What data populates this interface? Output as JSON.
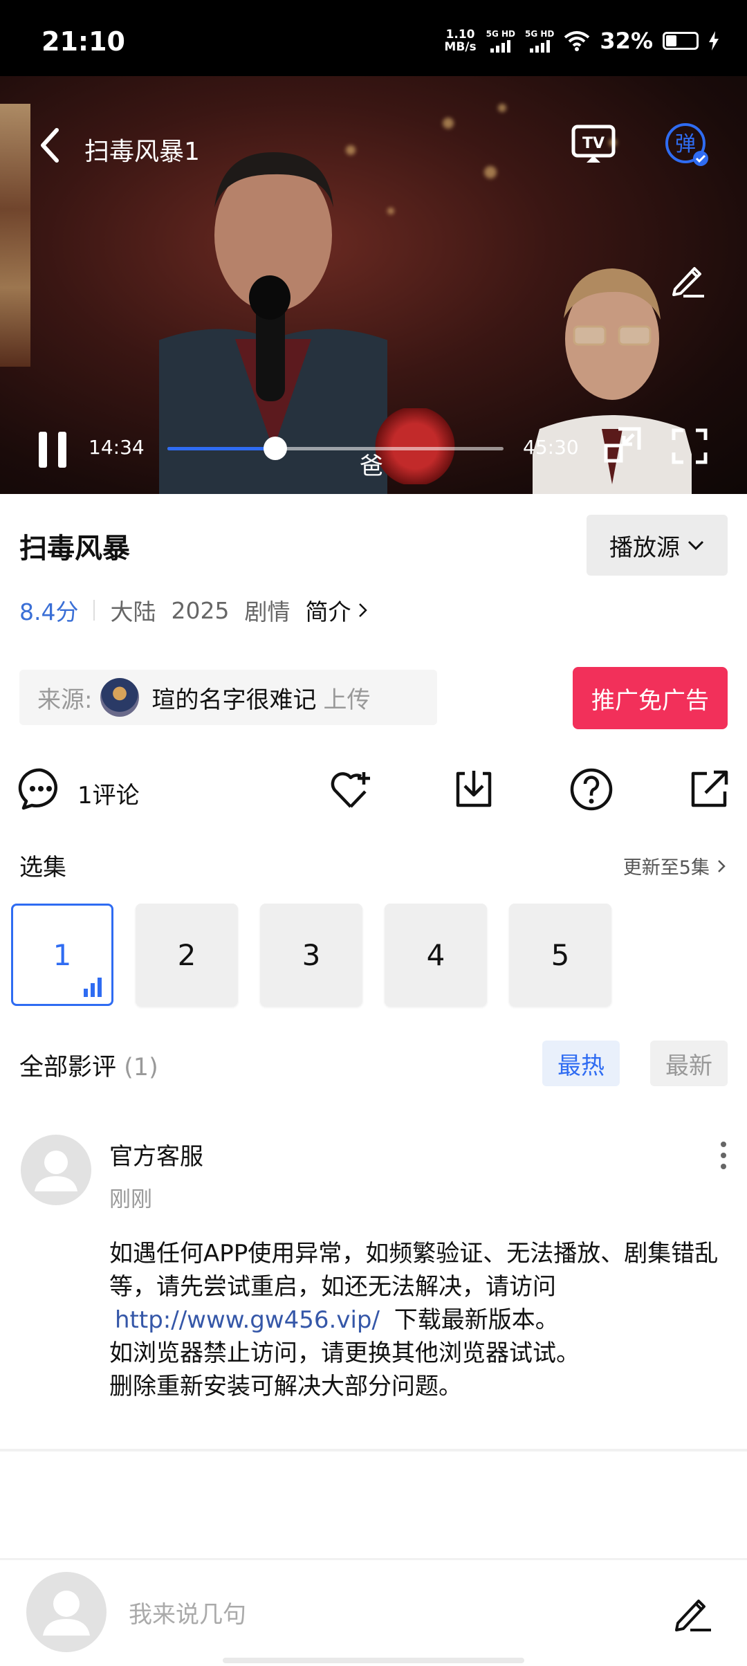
{
  "status_bar": {
    "time": "21:10",
    "net_speed": "1.10",
    "net_unit": "MB/s",
    "sim1": "5G HD",
    "sim2": "5G HD",
    "battery": "32%"
  },
  "player": {
    "title": "扫毒风暴1",
    "subtitle_text": "爸",
    "current_time": "14:34",
    "total_time": "45:30",
    "progress": 0.32,
    "tv_label": "TV",
    "danmaku_label": "弹"
  },
  "info": {
    "title": "扫毒风暴",
    "source_button": "播放源",
    "score": "8.4分",
    "region": "大陆",
    "year": "2025",
    "genre": "剧情",
    "intro": "简介"
  },
  "uploader": {
    "prefix": "来源:",
    "name": "瑄的名字很难记",
    "suffix": "上传"
  },
  "promo_button": "推广免广告",
  "actions": {
    "comments_label": "1评论"
  },
  "episodes": {
    "heading": "选集",
    "update_text": "更新至5集",
    "items": [
      "1",
      "2",
      "3",
      "4",
      "5"
    ],
    "active": "1"
  },
  "reviews": {
    "heading": "全部影评",
    "count": "(1)",
    "tab_hot": "最热",
    "tab_new": "最新"
  },
  "comment": {
    "author": "官方客服",
    "time": "刚刚",
    "body_line1": "如遇任何APP使用异常，如频繁验证、无法播放、剧集错乱等，请先尝试重启，如还无法解决，请访问",
    "link": "http://www.gw456.vip/",
    "body_line2": "下载最新版本。",
    "body_line3": "如浏览器禁止访问，请更换其他浏览器试试。",
    "body_line4": "删除重新安装可解决大部分问题。"
  },
  "composer": {
    "placeholder": "我来说几句"
  },
  "colors": {
    "accent": "#2f6cf2",
    "promo": "#f2305a",
    "link": "#3557a8"
  }
}
